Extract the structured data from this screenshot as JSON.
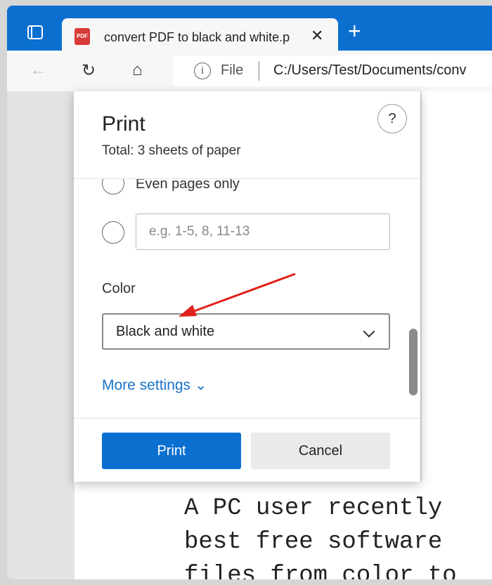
{
  "browser": {
    "tab_title": "convert PDF to black and white.p",
    "pdf_badge": "PDF",
    "file_label": "File",
    "url": "C:/Users/Test/Documents/conv",
    "new_tab": "+",
    "close": "✕",
    "back": "←",
    "refresh": "↻",
    "home": "⌂",
    "info": "i"
  },
  "dialog": {
    "title": "Print",
    "subtitle": "Total: 3 sheets of paper",
    "help": "?",
    "even_pages": "Even pages only",
    "range_placeholder": "e.g. 1-5, 8, 11-13",
    "color_label": "Color",
    "color_value": "Black and white",
    "more_settings": "More settings ⌄",
    "print_button": "Print",
    "cancel_button": "Cancel"
  },
  "document": {
    "lines": [
      "A PC user recently",
      "best free software",
      "files from color to"
    ]
  },
  "colors": {
    "accent": "#0b6fd0",
    "arrow": "#e0201a"
  }
}
